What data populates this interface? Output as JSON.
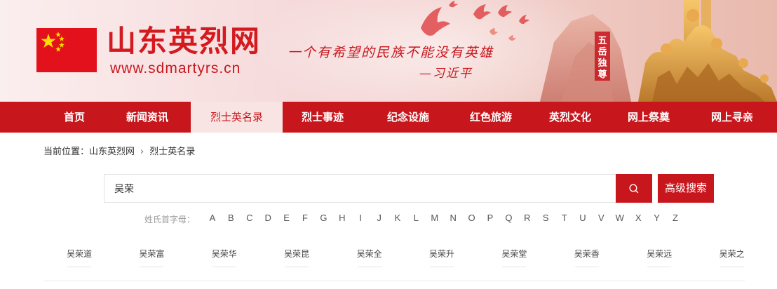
{
  "header": {
    "site_title": "山东英烈网",
    "site_url": "www.sdmartyrs.cn",
    "slogan": "一个有希望的民族不能没有英雄",
    "slogan_author": "—习近平",
    "monument_inscription": "五岳独尊"
  },
  "nav": {
    "items": [
      {
        "label": "首页"
      },
      {
        "label": "新闻资讯"
      },
      {
        "label": "烈士英名录"
      },
      {
        "label": "烈士事迹"
      },
      {
        "label": "纪念设施"
      },
      {
        "label": "红色旅游"
      },
      {
        "label": "英烈文化"
      },
      {
        "label": "网上祭奠"
      },
      {
        "label": "网上寻亲"
      }
    ],
    "active_index": 2
  },
  "breadcrumb": {
    "prefix": "当前位置：",
    "items": [
      "山东英烈网",
      "烈士英名录"
    ]
  },
  "search": {
    "value": "吴荣",
    "advanced_label": "高级搜索"
  },
  "letters": {
    "label": "姓氏首字母：",
    "items": [
      "A",
      "B",
      "C",
      "D",
      "E",
      "F",
      "G",
      "H",
      "I",
      "J",
      "K",
      "L",
      "M",
      "N",
      "O",
      "P",
      "Q",
      "R",
      "S",
      "T",
      "U",
      "V",
      "W",
      "X",
      "Y",
      "Z"
    ]
  },
  "names": [
    "吴荣道",
    "吴荣富",
    "吴荣华",
    "吴荣昆",
    "吴荣全",
    "吴荣升",
    "吴荣堂",
    "吴荣香",
    "吴荣远",
    "吴荣之"
  ],
  "colors": {
    "primary": "#c8161d",
    "nav_active_bg": "#f8e4e2",
    "flag_red": "#e3111b",
    "flag_star": "#ffde00"
  }
}
